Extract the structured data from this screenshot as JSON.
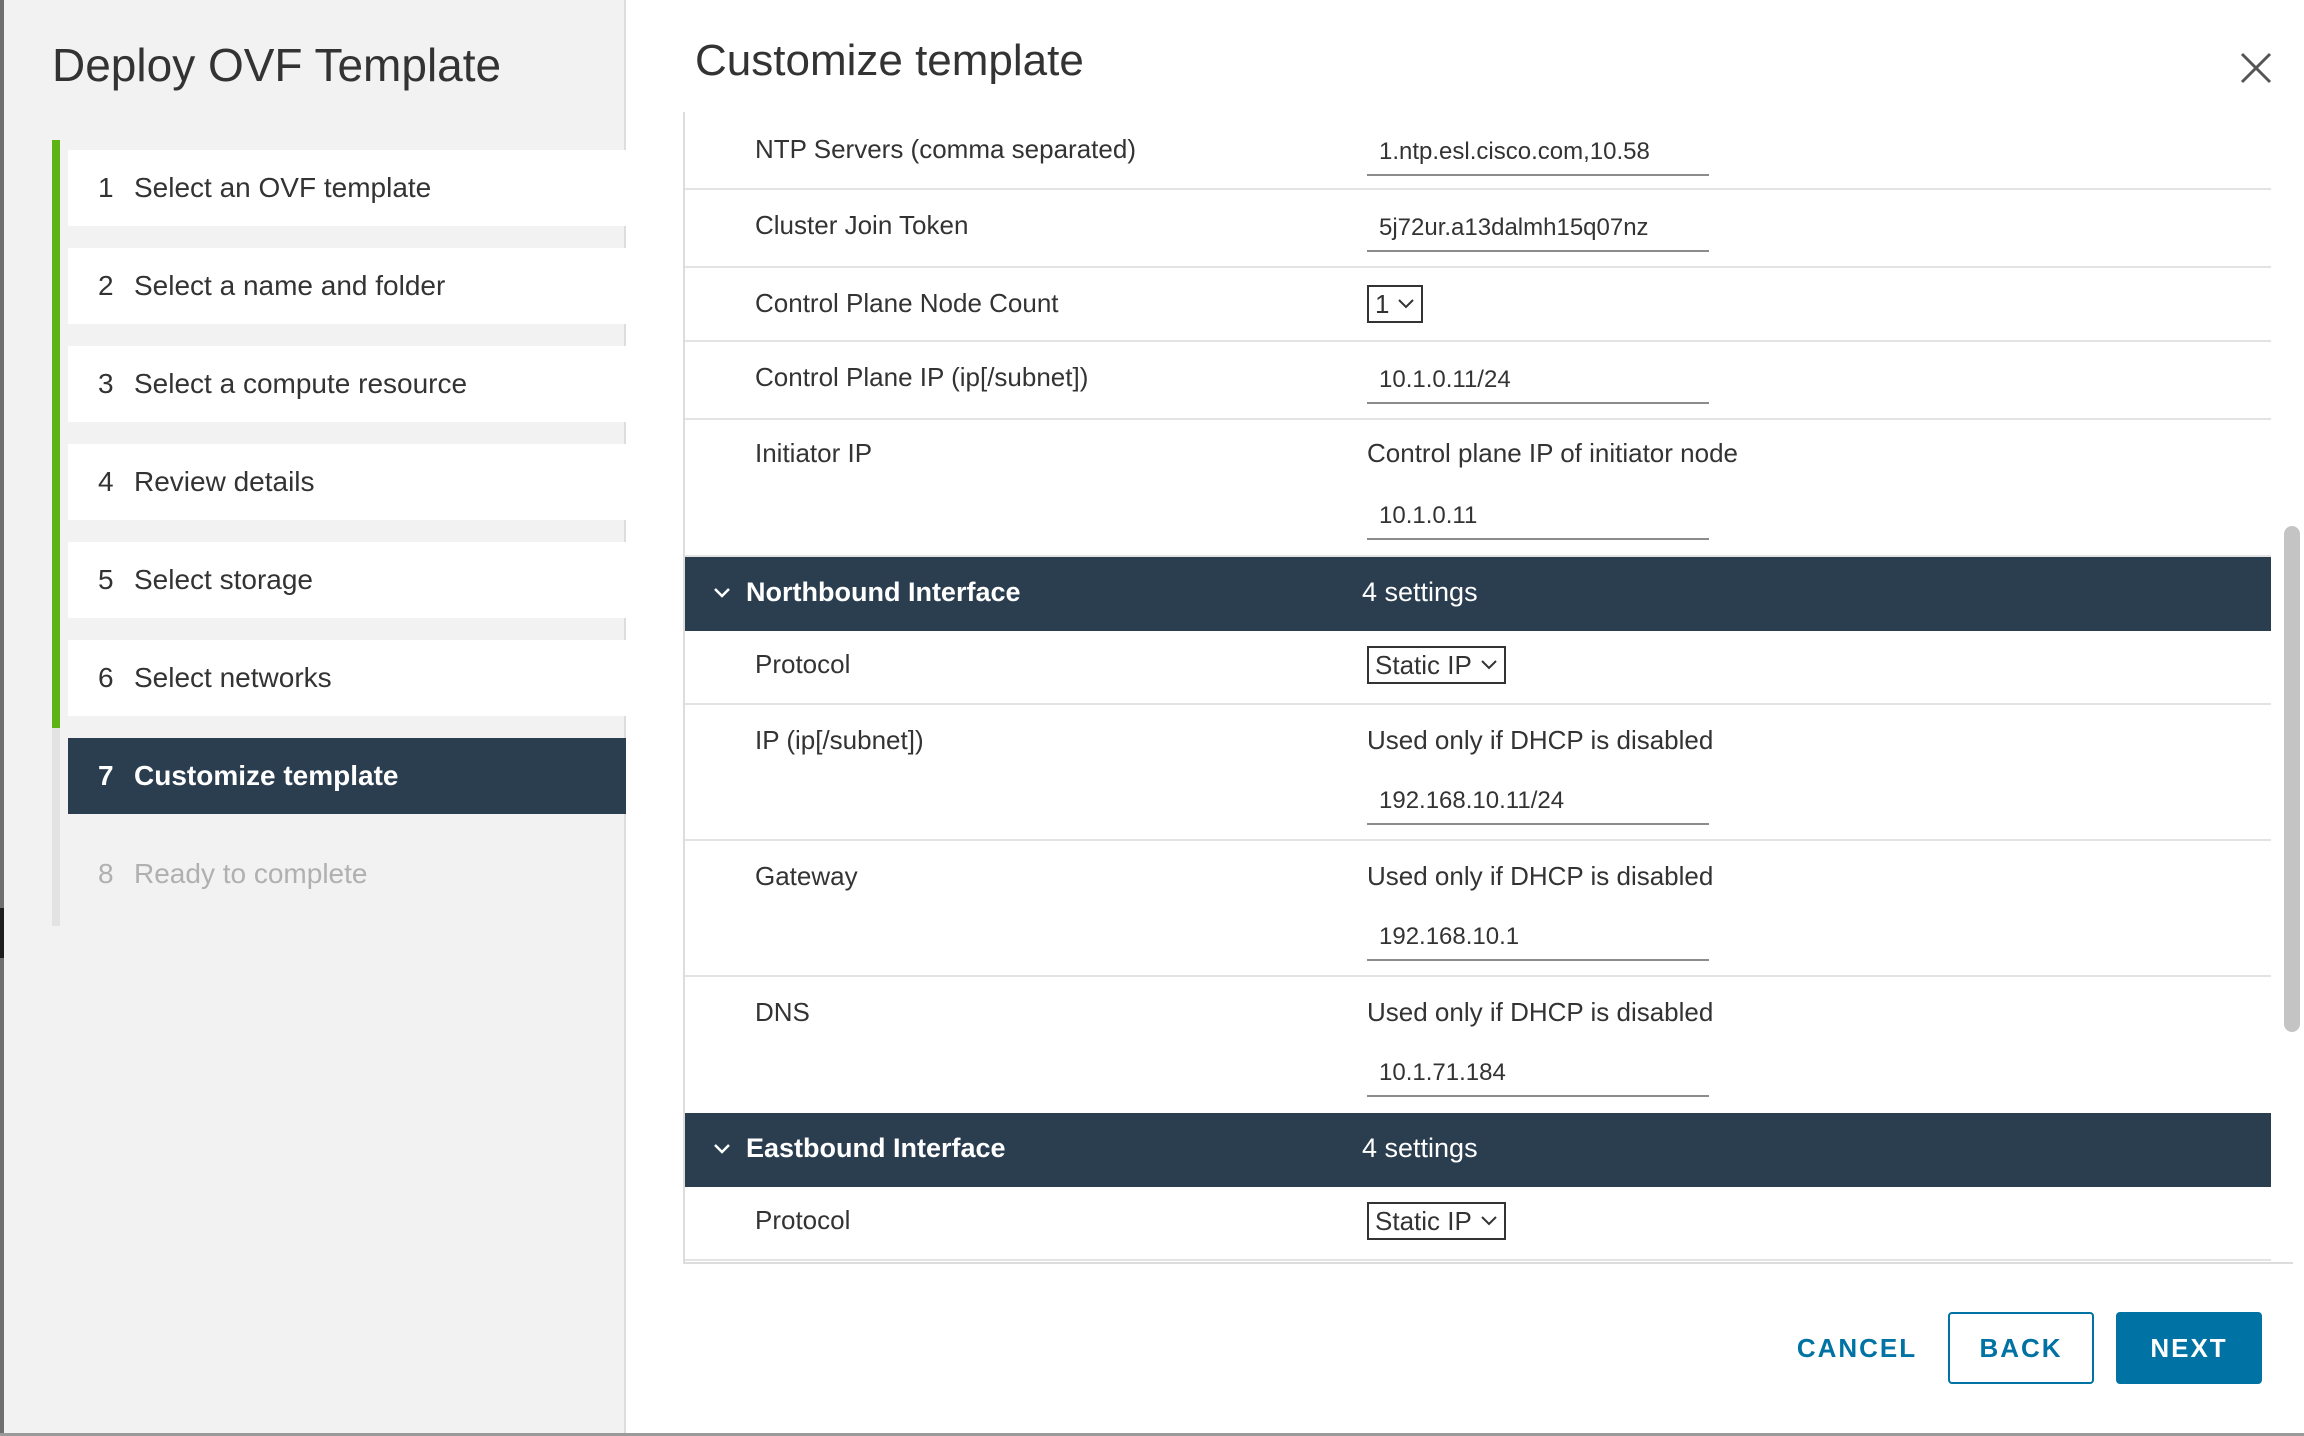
{
  "wizard": {
    "title": "Deploy OVF Template",
    "steps": [
      {
        "num": "1",
        "label": "Select an OVF template"
      },
      {
        "num": "2",
        "label": "Select a name and folder"
      },
      {
        "num": "3",
        "label": "Select a compute resource"
      },
      {
        "num": "4",
        "label": "Review details"
      },
      {
        "num": "5",
        "label": "Select storage"
      },
      {
        "num": "6",
        "label": "Select networks"
      },
      {
        "num": "7",
        "label": "Customize template"
      },
      {
        "num": "8",
        "label": "Ready to complete"
      }
    ],
    "active_step": 7
  },
  "main": {
    "title": "Customize template",
    "close_icon": "close-icon",
    "rows": {
      "ntp": {
        "label": "NTP Servers (comma separated)",
        "value": "1.ntp.esl.cisco.com,10.58"
      },
      "token": {
        "label": "Cluster Join Token",
        "value": "5j72ur.a13dalmh15q07nz"
      },
      "node_count": {
        "label": "Control Plane Node Count",
        "value": "1"
      },
      "cp_ip": {
        "label": "Control Plane IP (ip[/subnet])",
        "value": "10.1.0.11/24"
      },
      "initiator": {
        "label": "Initiator IP",
        "description": "Control plane IP of initiator node",
        "value": "10.1.0.11"
      }
    },
    "northbound": {
      "title": "Northbound Interface",
      "count": "4 settings",
      "protocol": {
        "label": "Protocol",
        "value": "Static IP"
      },
      "ip": {
        "label": "IP (ip[/subnet])",
        "description": "Used only if DHCP is disabled",
        "value": "192.168.10.11/24"
      },
      "gateway": {
        "label": "Gateway",
        "description": "Used only if DHCP is disabled",
        "value": "192.168.10.1"
      },
      "dns": {
        "label": "DNS",
        "description": "Used only if DHCP is disabled",
        "value": "10.1.71.184"
      }
    },
    "eastbound": {
      "title": "Eastbound Interface",
      "count": "4 settings",
      "protocol": {
        "label": "Protocol",
        "value": "Static IP"
      }
    }
  },
  "footer": {
    "cancel": "CANCEL",
    "back": "BACK",
    "next": "NEXT"
  },
  "colors": {
    "section_bg": "#2b3e50",
    "accent": "#0072a3",
    "progress": "#5eb314"
  }
}
